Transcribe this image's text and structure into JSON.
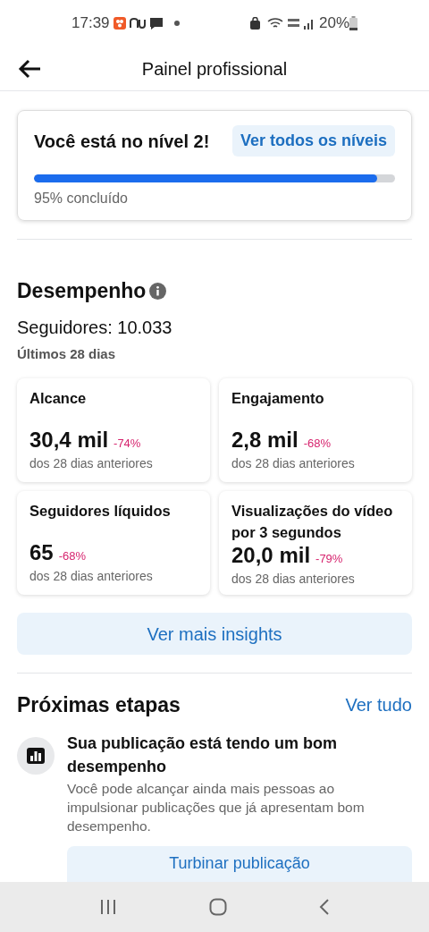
{
  "status_bar": {
    "time": "17:39",
    "battery": "20%"
  },
  "header": {
    "title": "Painel profissional"
  },
  "level_card": {
    "title": "Você está no nível 2!",
    "link": "Ver todos os níveis",
    "level": 0.95,
    "progress_text": "95% concluído"
  },
  "performance": {
    "title": "Desempenho",
    "followers": "Seguidores: 10.033",
    "period": "Últimos 28 dias",
    "metrics": [
      {
        "title": "Alcance",
        "value": "30,4 mil",
        "change": "-74%",
        "caption": "dos 28 dias anteriores"
      },
      {
        "title": "Engajamento",
        "value": "2,8 mil",
        "change": "-68%",
        "caption": "dos 28 dias anteriores"
      },
      {
        "title": "Seguidores líquidos",
        "value": "65",
        "change": "-68%",
        "caption": "dos 28 dias anteriores"
      },
      {
        "title": "Visualizações do vídeo por 3 segundos",
        "value": "20,0 mil",
        "change": "-79%",
        "caption": "dos 28 dias anteriores"
      }
    ],
    "button": "Ver mais insights"
  },
  "next_steps": {
    "title": "Próximas etapas",
    "link": "Ver tudo",
    "items": [
      {
        "title": "Sua publicação está tendo um bom desempenho",
        "description": "Você pode alcançar ainda mais pessoas ao impulsionar publicações que já apresentam bom desempenho.",
        "button": "Turbinar publicação"
      }
    ]
  }
}
